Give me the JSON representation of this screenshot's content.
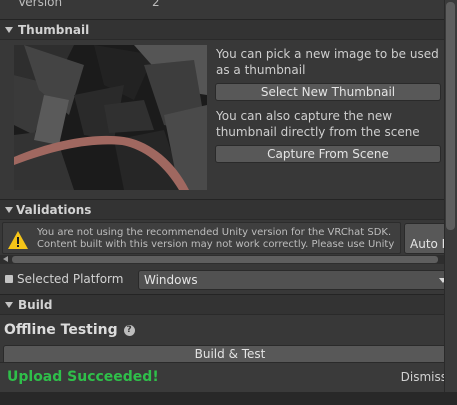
{
  "version_row": {
    "label": "Version",
    "value": "2"
  },
  "thumbnail": {
    "section_title": "Thumbnail",
    "pick_text": "You can pick a new image to be used as a thumbnail",
    "select_button": "Select New Thumbnail",
    "capture_text": "You can also capture the new thumbnail directly from the scene",
    "capture_button": "Capture From Scene"
  },
  "validations": {
    "section_title": "Validations",
    "line1": "You are not using the recommended Unity version for the VRChat SDK.",
    "line2": "Content built with this version may not work correctly. Please use Unity",
    "autofix_button": "Auto F"
  },
  "platform": {
    "label": "Selected Platform",
    "selected": "Windows"
  },
  "build": {
    "section_title": "Build",
    "offline_title": "Offline Testing",
    "help_glyph": "?",
    "build_test_button": "Build & Test"
  },
  "status": {
    "message": "Upload Succeeded!",
    "dismiss": "Dismiss"
  },
  "colors": {
    "success": "#2fbf4a",
    "warning": "#f5c518"
  }
}
